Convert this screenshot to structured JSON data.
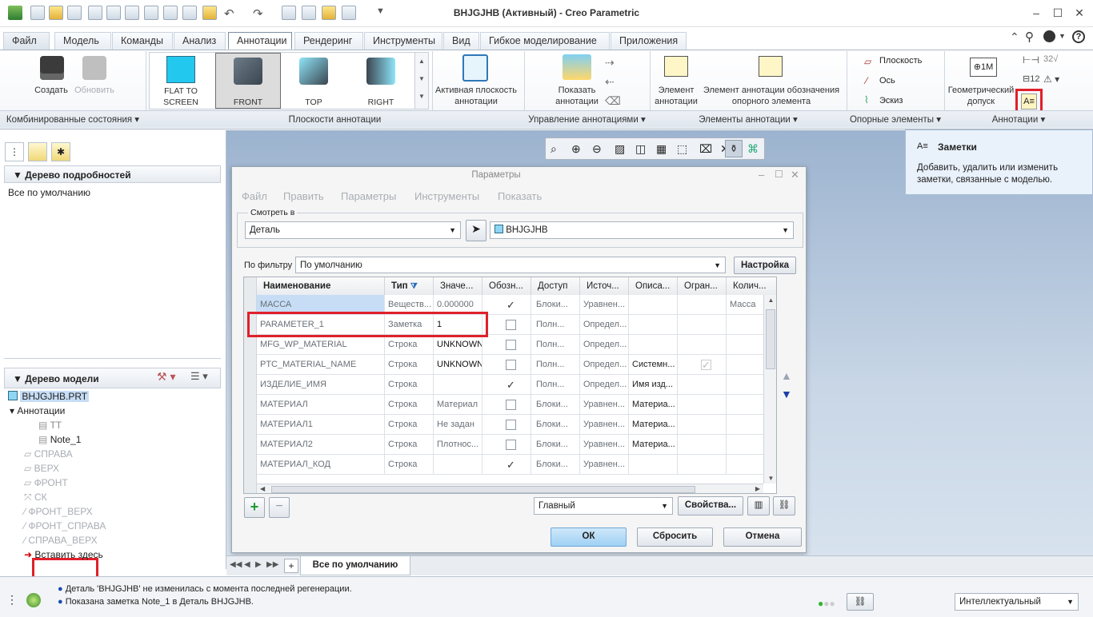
{
  "title": "BHJGJHB (Активный) - Creo Parametric",
  "menu_tabs": [
    "Файл",
    "Модель",
    "Команды",
    "Анализ",
    "Аннотации",
    "Рендеринг",
    "Инструменты",
    "Вид",
    "Гибкое моделирование",
    "Приложения"
  ],
  "ribbon": {
    "create": "Создать",
    "update": "Обновить",
    "views": [
      "FLAT TO SCREEN",
      "FRONT",
      "TOP",
      "RIGHT"
    ],
    "active_plane": "Активная плоскость аннотации",
    "show_annot": "Показать аннотации",
    "annot_element": "Элемент аннотации",
    "datum_annot": "Элемент аннотации обозначения опорного элемента",
    "plane": "Плоскость",
    "axis": "Ось",
    "sketch": "Эскиз",
    "geom_tol": "Геометрический допуск",
    "groups": [
      "Комбинированные состояния",
      "Плоскости аннотации",
      "Управление аннотациями",
      "Элементы аннотации",
      "Опорные элементы",
      "Аннотации"
    ]
  },
  "detail_tree": {
    "header": "Дерево подробностей",
    "item": "Все по умолчанию"
  },
  "model_tree": {
    "header": "Дерево модели",
    "root": "BHJGJHB.PRT",
    "annotations": "Аннотации",
    "items": [
      "TT",
      "Note_1",
      "СПРАВА",
      "ВЕРХ",
      "ФРОНТ",
      "СК",
      "ФРОНТ_ВЕРХ",
      "ФРОНТ_СПРАВА",
      "СПРАВА_ВЕРХ",
      "Вставить здесь"
    ]
  },
  "tooltip": {
    "title": "Заметки",
    "text": "Добавить, удалить или изменить заметки, связанные с моделью."
  },
  "dialog": {
    "title": "Параметры",
    "menu": [
      "Файл",
      "Править",
      "Параметры",
      "Инструменты",
      "Показать"
    ],
    "look_in_label": "Смотреть в",
    "look_in_value": "Деталь",
    "object_value": "BHJGJHB",
    "filter_label": "По фильтру",
    "filter_value": "По умолчанию",
    "setup_button": "Настройка",
    "columns": [
      "Наименование",
      "Тип",
      "Значе...",
      "Обозн...",
      "Доступ",
      "Источ...",
      "Описа...",
      "Огран...",
      "Колич..."
    ],
    "rows": [
      {
        "name": "МАССА",
        "type": "Вещеcтв...",
        "value": "0.000000",
        "designated": true,
        "access": "Блоки...",
        "source": "Уравнен...",
        "desc": "",
        "restricted": false,
        "unit": "Масса"
      },
      {
        "name": "PARAMETER_1",
        "type": "Заметка",
        "value": "1",
        "designated": false,
        "access": "Полн...",
        "source": "Определ...",
        "desc": "",
        "restricted": false,
        "unit": ""
      },
      {
        "name": "MFG_WP_MATERIAL",
        "type": "Строка",
        "value": "UNKNOWN",
        "designated": false,
        "access": "Полн...",
        "source": "Определ...",
        "desc": "",
        "restricted": false,
        "unit": ""
      },
      {
        "name": "PTC_MATERIAL_NAME",
        "type": "Строка",
        "value": "UNKNOWN",
        "designated": false,
        "access": "Полн...",
        "source": "Определ...",
        "desc": "Системн...",
        "restricted": true,
        "unit": ""
      },
      {
        "name": "ИЗДЕЛИЕ_ИМЯ",
        "type": "Строка",
        "value": "",
        "designated": true,
        "access": "Полн...",
        "source": "Определ...",
        "desc": "Имя изд...",
        "restricted": false,
        "unit": ""
      },
      {
        "name": "МАТЕРИАЛ",
        "type": "Строка",
        "value": "Материал",
        "designated": false,
        "access": "Блоки...",
        "source": "Уравнен...",
        "desc": "Материа...",
        "restricted": false,
        "unit": ""
      },
      {
        "name": "МАТЕРИАЛ1",
        "type": "Строка",
        "value": "Не задан",
        "designated": false,
        "access": "Блоки...",
        "source": "Уравнен...",
        "desc": "Материа...",
        "restricted": false,
        "unit": ""
      },
      {
        "name": "МАТЕРИАЛ2",
        "type": "Строка",
        "value": "Плотнос...",
        "designated": false,
        "access": "Блоки...",
        "source": "Уравнен...",
        "desc": "Материа...",
        "restricted": false,
        "unit": ""
      },
      {
        "name": "МАТЕРИАЛ_КОД",
        "type": "Строка",
        "value": "",
        "designated": true,
        "access": "Блоки...",
        "source": "Уравнен...",
        "desc": "",
        "restricted": false,
        "unit": ""
      }
    ],
    "main_select": "Главный",
    "properties_button": "Свойства...",
    "ok": "ОК",
    "reset": "Сбросить",
    "cancel": "Отмена"
  },
  "bottom_tab": "Все по умолчанию",
  "status": {
    "line1": "Деталь 'BHJGJHB' не изменилась с момента последней регенерации.",
    "line2": "Показана заметка Note_1 в Деталь BHJGJHB.",
    "mode": "Интеллектуальный"
  },
  "colors": {
    "accent_red": "#e0202a",
    "selection": "#c6ddf5",
    "canvas_top": "#9cb3cf"
  }
}
